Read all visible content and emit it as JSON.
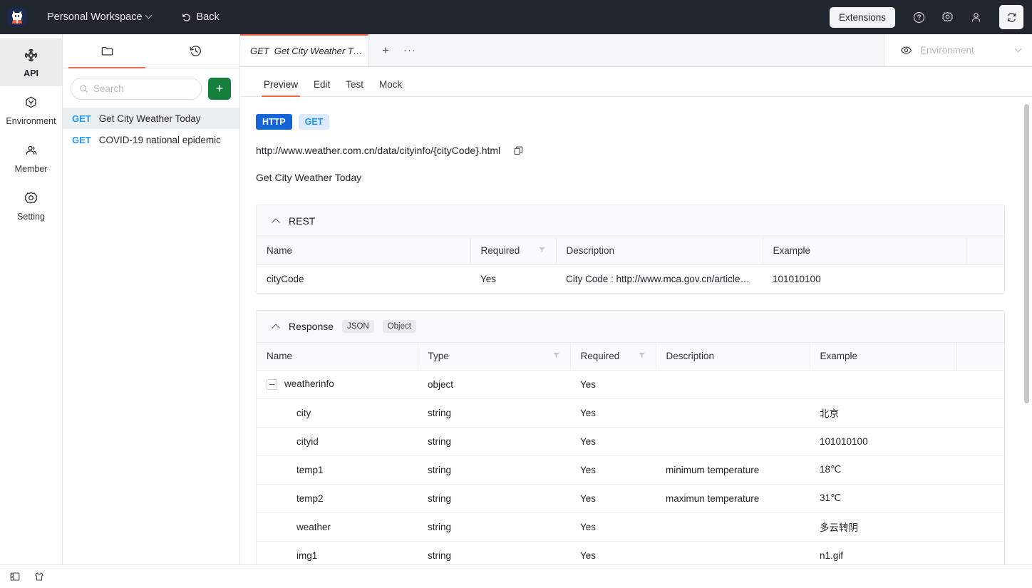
{
  "topbar": {
    "logo_icon": "apifox-cat-logo",
    "workspace": "Personal Workspace",
    "workspace_chevron_icon": "chevron-down-icon",
    "back_icon": "undo-arrow-icon",
    "back_label": "Back",
    "extensions_label": "Extensions",
    "help_icon": "question-circle-icon",
    "settings_icon": "gear-icon",
    "account_icon": "user-icon",
    "refresh_icon": "refresh-icon"
  },
  "rail": {
    "items": [
      {
        "label": "API",
        "icon": "api-plug-icon",
        "active": true
      },
      {
        "label": "Environment",
        "icon": "hexagon-environment-icon",
        "active": false
      },
      {
        "label": "Member",
        "icon": "member-people-icon",
        "active": false
      },
      {
        "label": "Setting",
        "icon": "gear-icon",
        "active": false
      }
    ]
  },
  "listpanel": {
    "tabs": [
      {
        "name": "folder-tab",
        "icon": "folder-icon",
        "active": true
      },
      {
        "name": "history-tab",
        "icon": "history-clock-icon",
        "active": false
      }
    ],
    "search": {
      "placeholder": "Search",
      "value": "",
      "icon": "search-icon"
    },
    "add_button": {
      "label": "+",
      "icon": "plus-icon"
    },
    "items": [
      {
        "method": "GET",
        "title": "Get City Weather Today",
        "selected": true
      },
      {
        "method": "GET",
        "title": "COVID-19 national epidemic",
        "selected": false
      }
    ]
  },
  "tabbar": {
    "doc_tab": {
      "method": "GET",
      "title": "Get City Weather T…"
    },
    "new_tab_label": "+",
    "more_label": "···",
    "environment": {
      "eye_icon": "eye-icon",
      "placeholder": "Environment",
      "chevron_icon": "chevron-down-icon"
    }
  },
  "subtabs": [
    {
      "label": "Preview",
      "active": true
    },
    {
      "label": "Edit",
      "active": false
    },
    {
      "label": "Test",
      "active": false
    },
    {
      "label": "Mock",
      "active": false
    }
  ],
  "api": {
    "protocol_badge": "HTTP",
    "method_badge": "GET",
    "url": "http://www.weather.com.cn/data/cityinfo/{cityCode}.html",
    "copy_icon": "copy-icon",
    "description": "Get City Weather Today"
  },
  "rest_section": {
    "title": "REST",
    "collapse_icon": "chevron-up-icon",
    "columns": [
      "Name",
      "Required",
      "Description",
      "Example",
      ""
    ],
    "filter_icon": "filter-icon",
    "rows": [
      {
        "name": "cityCode",
        "required": "Yes",
        "description": "City Code : http://www.mca.gov.cn/article…",
        "example": "101010100"
      }
    ]
  },
  "response_section": {
    "title": "Response",
    "collapse_icon": "chevron-up-icon",
    "badges": [
      "JSON",
      "Object"
    ],
    "columns": [
      "Name",
      "Type",
      "Required",
      "Description",
      "Example",
      ""
    ],
    "filter_icon": "filter-icon",
    "rows": [
      {
        "name": "weatherinfo",
        "type": "object",
        "required": "Yes",
        "description": "",
        "example": "",
        "expandable": true,
        "indent": 0
      },
      {
        "name": "city",
        "type": "string",
        "required": "Yes",
        "description": "",
        "example": "北京",
        "expandable": false,
        "indent": 1
      },
      {
        "name": "cityid",
        "type": "string",
        "required": "Yes",
        "description": "",
        "example": "101010100",
        "expandable": false,
        "indent": 1
      },
      {
        "name": "temp1",
        "type": "string",
        "required": "Yes",
        "description": "minimum temperature",
        "example": "18℃",
        "expandable": false,
        "indent": 1
      },
      {
        "name": "temp2",
        "type": "string",
        "required": "Yes",
        "description": "maximun temperature",
        "example": "31℃",
        "expandable": false,
        "indent": 1
      },
      {
        "name": "weather",
        "type": "string",
        "required": "Yes",
        "description": "",
        "example": "多云转阴",
        "expandable": false,
        "indent": 1
      },
      {
        "name": "img1",
        "type": "string",
        "required": "Yes",
        "description": "",
        "example": "n1.gif",
        "expandable": false,
        "indent": 1
      }
    ]
  },
  "statusbar": {
    "panel_toggle_icon": "panel-layout-icon",
    "theme_icon": "shirt-icon"
  },
  "colors": {
    "accent": "#f1674a",
    "method_blue": "#2196f3",
    "http_blue": "#1565d8",
    "add_green": "#15803d",
    "topbar_bg": "#22262e"
  }
}
